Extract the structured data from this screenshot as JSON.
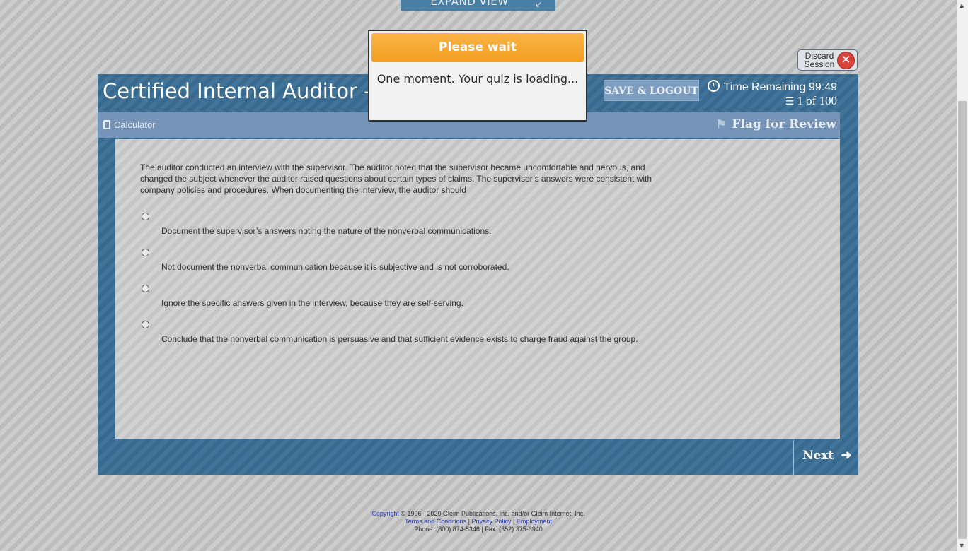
{
  "expand_view": {
    "label": "EXPAND VIEW",
    "icon": "expand-arrows-icon"
  },
  "discard": {
    "label_line1": "Discard",
    "label_line2": "Session",
    "icon": "close-icon"
  },
  "header": {
    "title": "Certified Internal Auditor - Pa",
    "save_logout_label": "SAVE & LOGOUT",
    "time_remaining": "Time Remaining 99:49",
    "progress": "1 of 100"
  },
  "toolbar": {
    "calculator_label": "Calculator",
    "flag_label": "Flag for Review"
  },
  "question": {
    "stem": "The auditor conducted an interview with the supervisor. The auditor noted that the supervisor became uncomfortable and nervous, and changed the subject whenever the auditor raised questions about certain types of claims. The supervisor’s answers were consistent with company policies and procedures. When documenting the interview, the auditor should",
    "choices": [
      "Document the supervisor’s answers noting the nature of the nonverbal communications.",
      "Not document the nonverbal communication because it is subjective and is not corroborated.",
      "Ignore the specific answers given in the interview, because they are self-serving.",
      "Conclude that the nonverbal communication is persuasive and that sufficient evidence exists to charge fraud against the group."
    ]
  },
  "navigation": {
    "next_label": "Next"
  },
  "footer": {
    "copyright_link": "Copyright",
    "copyright_text": " © 1996 - 2020 Gleim Publications, Inc. and/or Gleim Internet, Inc.",
    "terms": "Terms and Conditions",
    "privacy": "Privacy Policy",
    "employment": "Employment",
    "sep": " | ",
    "contact": "Phone: (800) 874-5346 | Fax: (352) 375-6940"
  },
  "modal": {
    "title": "Please wait",
    "message": "One moment. Your quiz is loading..."
  },
  "colors": {
    "frame": "#3a6e95",
    "toolbar": "#7694b8",
    "modal_header": "#f6a830"
  }
}
